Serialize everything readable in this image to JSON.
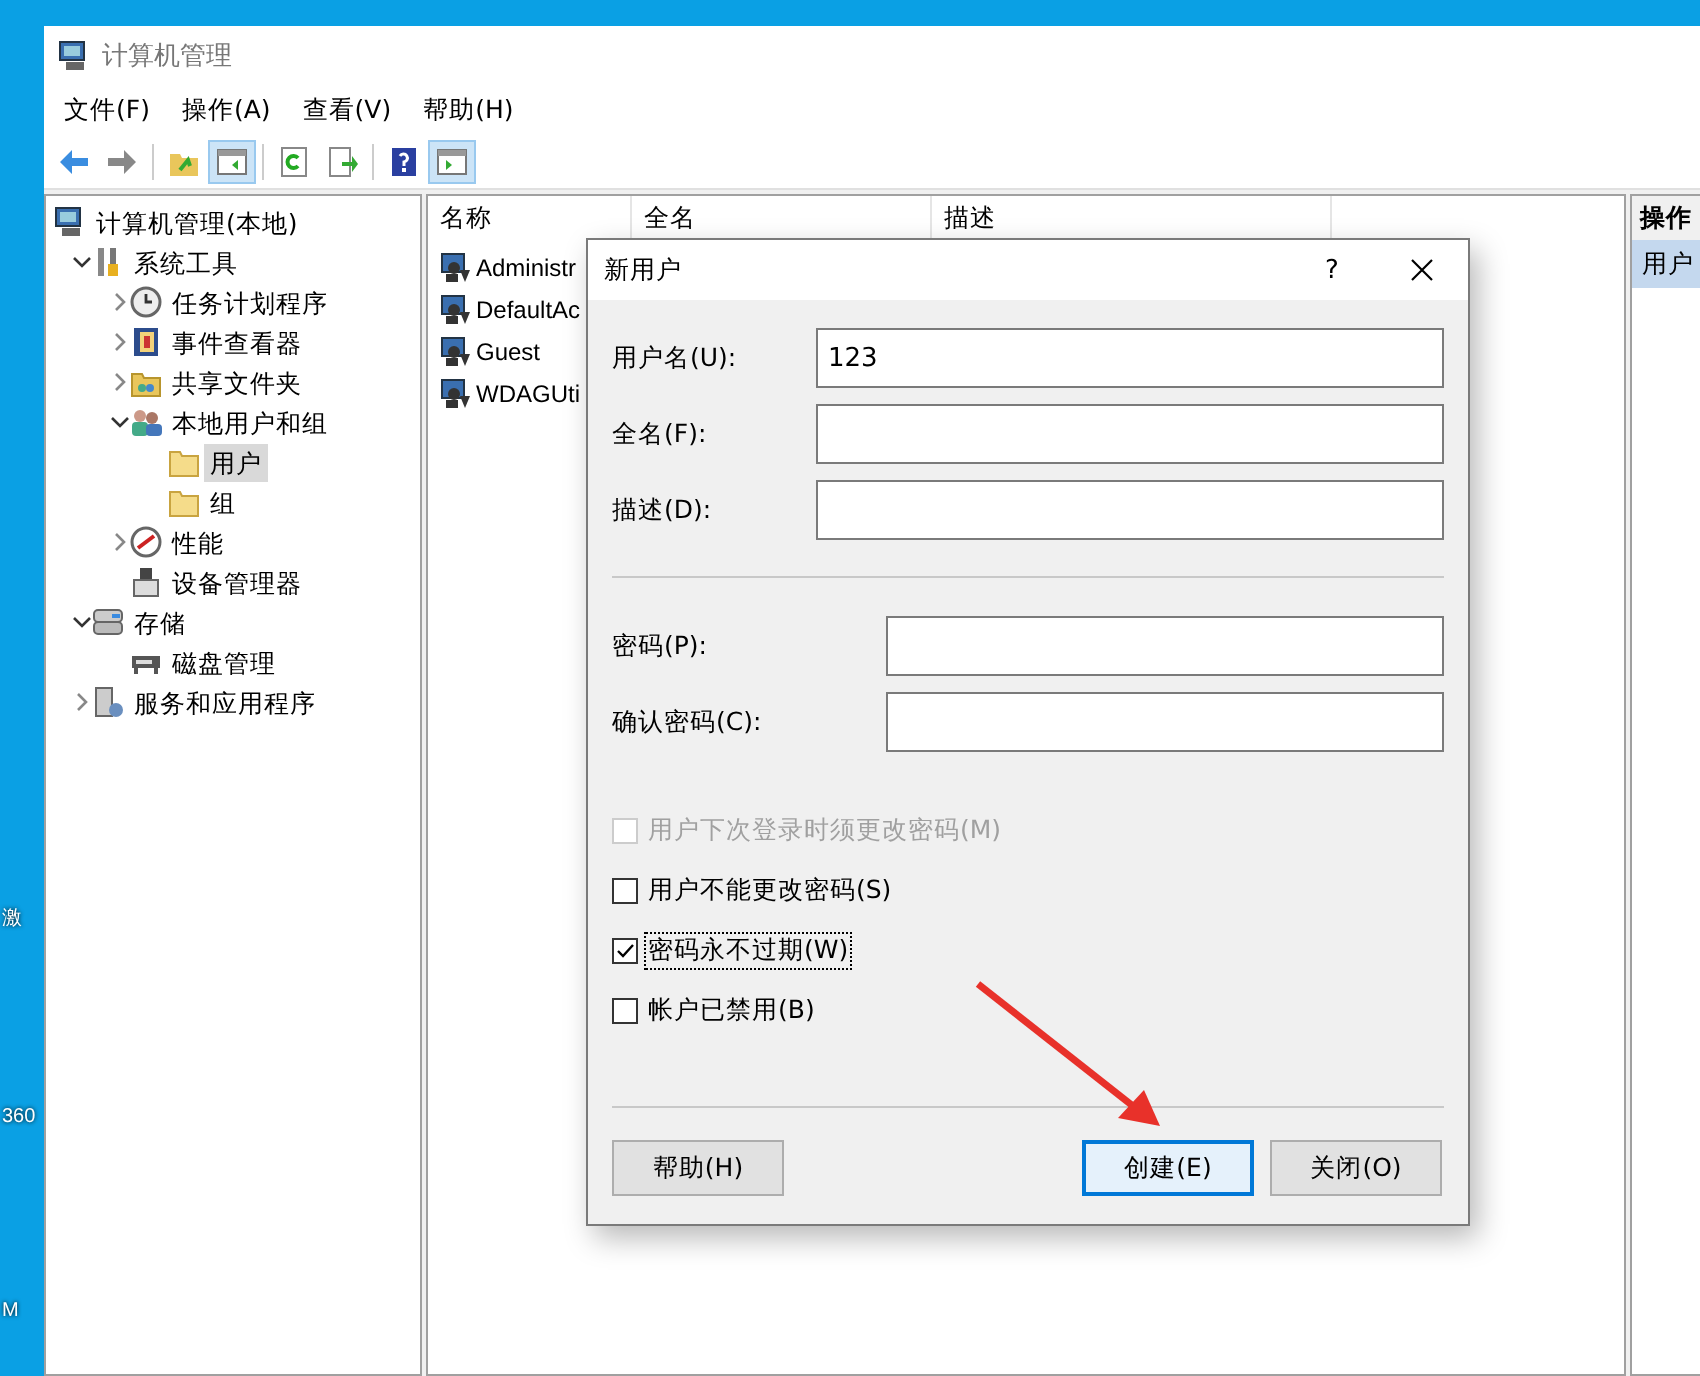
{
  "desktop_icons": [
    {
      "label": "激"
    },
    {
      "label": "360"
    },
    {
      "label": "M"
    }
  ],
  "window": {
    "title": "计算机管理"
  },
  "menu": [
    {
      "label": "文件(F)"
    },
    {
      "label": "操作(A)"
    },
    {
      "label": "查看(V)"
    },
    {
      "label": "帮助(H)"
    }
  ],
  "toolbar": [
    {
      "kind": "button",
      "pressed": false
    },
    {
      "kind": "button",
      "pressed": false
    },
    {
      "kind": "separator"
    },
    {
      "kind": "button",
      "pressed": false
    },
    {
      "kind": "button",
      "pressed": true
    },
    {
      "kind": "separator"
    },
    {
      "kind": "button",
      "pressed": false
    },
    {
      "kind": "button",
      "pressed": false
    },
    {
      "kind": "separator"
    },
    {
      "kind": "button",
      "pressed": false
    },
    {
      "kind": "button",
      "pressed": true
    }
  ],
  "tree": [
    {
      "label": "计算机管理(本地)",
      "selected": false,
      "children": [
        {
          "label": "系统工具",
          "expanded": true,
          "selected": false,
          "children": [
            {
              "label": "任务计划程序",
              "expanded": false,
              "selected": false
            },
            {
              "label": "事件查看器",
              "expanded": false,
              "selected": false
            },
            {
              "label": "共享文件夹",
              "expanded": false,
              "selected": false
            },
            {
              "label": "本地用户和组",
              "expanded": true,
              "selected": false,
              "children": [
                {
                  "label": "用户",
                  "selected": true
                },
                {
                  "label": "组",
                  "selected": false
                }
              ]
            },
            {
              "label": "性能",
              "expanded": false,
              "selected": false
            },
            {
              "label": "设备管理器",
              "selected": false
            }
          ]
        },
        {
          "label": "存储",
          "expanded": true,
          "selected": false,
          "children": [
            {
              "label": "磁盘管理",
              "selected": false
            }
          ]
        },
        {
          "label": "服务和应用程序",
          "expanded": false,
          "selected": false
        }
      ]
    }
  ],
  "table": {
    "columns": [
      "名称",
      "全名",
      "描述"
    ],
    "rows": [
      {
        "name": "Administr"
      },
      {
        "name": "DefaultAc"
      },
      {
        "name": "Guest"
      },
      {
        "name": "WDAGUti"
      }
    ]
  },
  "actions": {
    "title": "操作",
    "items": [
      {
        "label": "用户",
        "selected": true
      }
    ]
  },
  "dialog": {
    "title": "新用户",
    "help_glyph": "?",
    "fields": [
      {
        "label": "用户名(U):",
        "value": "123"
      },
      {
        "label": "全名(F):"
      },
      {
        "label": "描述(D):"
      }
    ],
    "password_fields": [
      {
        "label": "密码(P):"
      },
      {
        "label": "确认密码(C):"
      }
    ],
    "checkboxes": [
      {
        "label": "用户下次登录时须更改密码(M)",
        "checked": false,
        "disabled": true,
        "focused": false
      },
      {
        "label": "用户不能更改密码(S)",
        "checked": false,
        "disabled": false,
        "focused": false
      },
      {
        "label": "密码永不过期(W)",
        "checked": true,
        "disabled": false,
        "focused": true
      },
      {
        "label": "帐户已禁用(B)",
        "checked": false,
        "disabled": false,
        "focused": false
      }
    ],
    "buttons": [
      {
        "label": "帮助(H)",
        "default": false
      },
      {
        "label": "创建(E)",
        "default": true
      },
      {
        "label": "关闭(O)",
        "default": false
      }
    ]
  }
}
